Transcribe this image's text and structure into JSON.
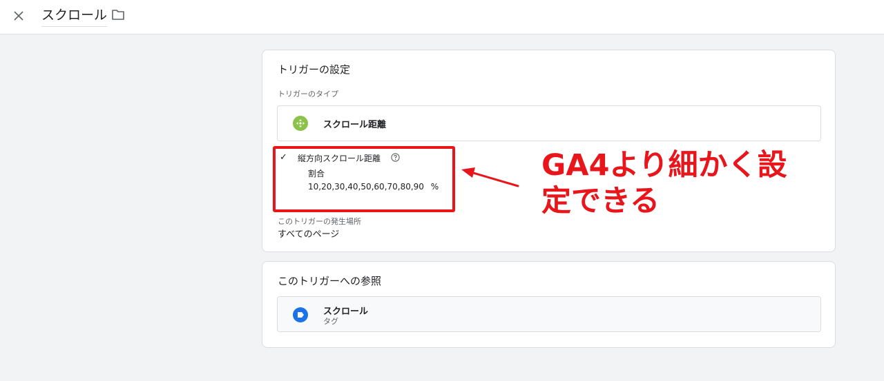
{
  "header": {
    "title": "スクロール",
    "close_icon": "close-icon",
    "folder_icon": "folder-icon"
  },
  "trigger_config": {
    "title": "トリガーの設定",
    "type_label": "トリガーのタイプ",
    "type_name": "スクロール距離",
    "type_icon": "move-arrows-icon",
    "vertical_scroll": {
      "checked": true,
      "label": "縦方向スクロール距離",
      "help_icon": "help-icon",
      "unit_label": "割合",
      "values": "10,20,30,40,50,60,70,80,90",
      "unit": "%"
    },
    "fires_on_label": "このトリガーの発生場所",
    "fires_on_value": "すべてのページ"
  },
  "references": {
    "title": "このトリガーへの参照",
    "items": [
      {
        "name": "スクロール",
        "kind": "タグ",
        "icon": "tag-icon"
      }
    ]
  },
  "annotation": {
    "text": "GA4より細かく設\n定できる",
    "color": "#e8151b"
  },
  "colors": {
    "accent_red": "#e8151b",
    "trigger_icon_green": "#8bc34a",
    "tag_icon_blue": "#1a73e8"
  }
}
